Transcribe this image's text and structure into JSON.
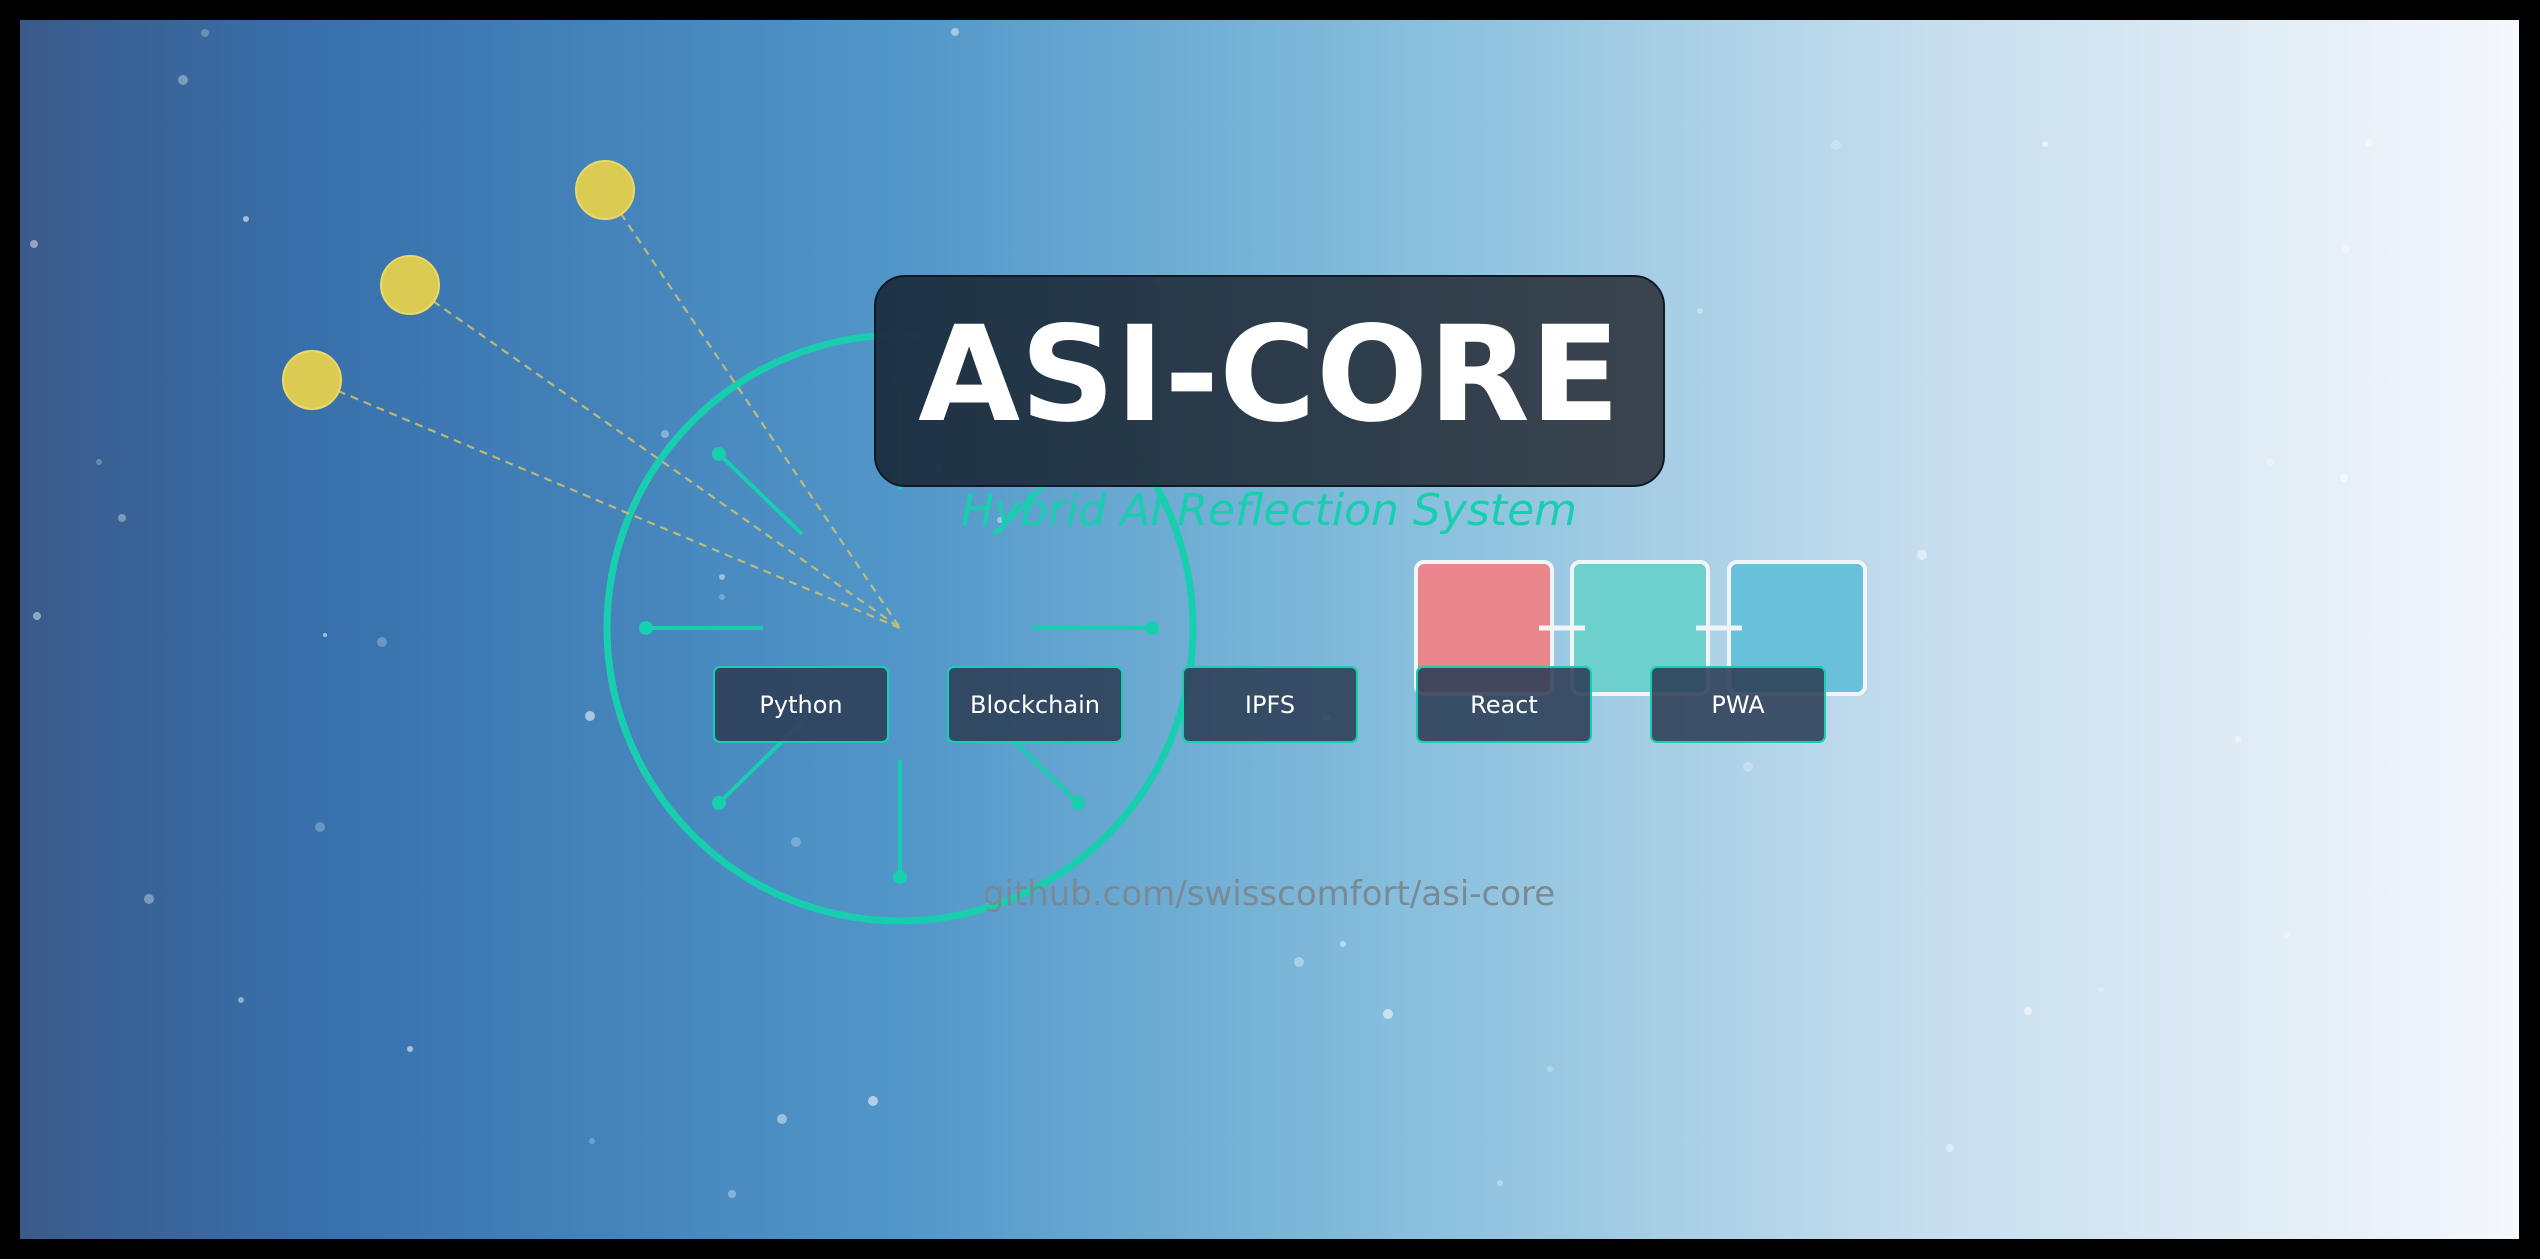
{
  "title": "ASI-CORE",
  "subtitle": "Hybrid AI Reflection System",
  "repo_link": "github.com/swisscomfort/asi-core",
  "tech_tags": [
    {
      "label": "Python"
    },
    {
      "label": "Blockchain"
    },
    {
      "label": "IPFS"
    },
    {
      "label": "React"
    },
    {
      "label": "PWA"
    }
  ],
  "colors": {
    "background_start": "#3a5a8a",
    "background_mid": "#3c78b4",
    "background_end": "#f4f7fb",
    "accent": "#17cfaf",
    "title_box": "#1e2d3c",
    "tag_box": "#2c3e55",
    "node_yellow": "#dccb52",
    "block_red": "#e8868c",
    "block_teal": "#6cd0cc",
    "block_blue": "#68c0da",
    "link_text": "#7a8a94"
  },
  "icons": {
    "core_network": "radial-hub-icon",
    "blockchain": "chained-blocks-icon",
    "satellites": "orbit-node-icon"
  }
}
